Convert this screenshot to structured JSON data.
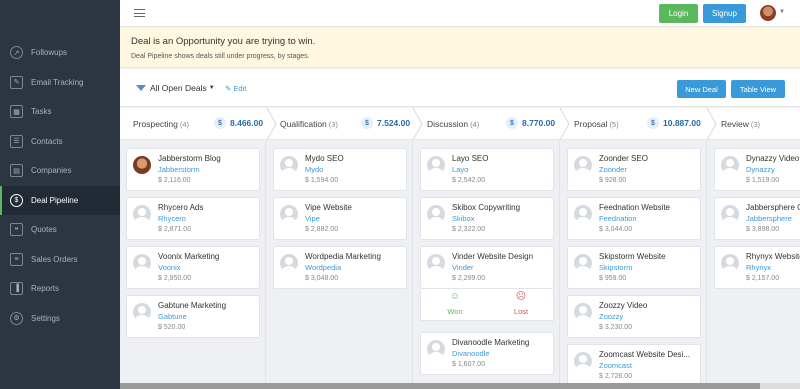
{
  "sidebar": {
    "items": [
      {
        "label": "Followups",
        "icon": "rocket-icon"
      },
      {
        "label": "Email Tracking",
        "icon": "edit-icon"
      },
      {
        "label": "Tasks",
        "icon": "calendar-icon"
      },
      {
        "label": "Contacts",
        "icon": "contacts-icon"
      },
      {
        "label": "Companies",
        "icon": "building-icon"
      },
      {
        "label": "Deal Pipeline",
        "icon": "dollar-icon",
        "active": true
      },
      {
        "label": "Quotes",
        "icon": "quote-icon"
      },
      {
        "label": "Sales Orders",
        "icon": "cart-icon"
      },
      {
        "label": "Reports",
        "icon": "bar-chart-icon"
      },
      {
        "label": "Settings",
        "icon": "gear-icon"
      }
    ]
  },
  "topbar": {
    "login_label": "Login",
    "signup_label": "Signup"
  },
  "banner": {
    "title": "Deal is an Opportunity you are trying to win.",
    "subtitle": "Deal Pipeline shows deals still under progress, by stages."
  },
  "toolbar": {
    "filter_label": "All Open Deals",
    "edit_label": "Edit",
    "new_deal_label": "New Deal",
    "table_view_label": "Table View"
  },
  "stages": [
    {
      "name": "Prospecting",
      "count": "(4)",
      "total": "8.466.00"
    },
    {
      "name": "Qualification",
      "count": "(3)",
      "total": "7.524.00"
    },
    {
      "name": "Discussion",
      "count": "(4)",
      "total": "8.770.00"
    },
    {
      "name": "Proposal",
      "count": "(5)",
      "total": "10.887.00"
    },
    {
      "name": "Review",
      "count": "(3)",
      "total": ""
    }
  ],
  "columns": [
    {
      "cards": [
        {
          "title": "Jabberstorm Blog",
          "org": "Jabberstorm",
          "amount": "$ 2,116.00",
          "photo": true
        },
        {
          "title": "Rhycero Ads",
          "org": "Rhycero",
          "amount": "$ 2,871.00"
        },
        {
          "title": "Voonix Marketing",
          "org": "Voonix",
          "amount": "$ 2,950.00"
        },
        {
          "title": "Gabtune Marketing",
          "org": "Gabtune",
          "amount": "$ 520.00"
        }
      ]
    },
    {
      "cards": [
        {
          "title": "Mydo SEO",
          "org": "Mydo",
          "amount": "$ 1,594.00"
        },
        {
          "title": "Vipe Website",
          "org": "Vipe",
          "amount": "$ 2,882.00"
        },
        {
          "title": "Wordpedia Marketing",
          "org": "Wordpedia",
          "amount": "$ 3,048.00"
        }
      ]
    },
    {
      "cards": [
        {
          "title": "Layo SEO",
          "org": "Layo",
          "amount": "$ 2,542.00"
        },
        {
          "title": "Skibox Copywriting",
          "org": "Skibox",
          "amount": "$ 2,322.00"
        },
        {
          "title": "Vinder Website Design",
          "org": "Vinder",
          "amount": "$ 2,299.00"
        },
        {
          "title": "Divanoodle Marketing",
          "org": "Divanoodle",
          "amount": "$ 1,607.00"
        }
      ],
      "won_label": "Won",
      "lost_label": "Lost"
    },
    {
      "cards": [
        {
          "title": "Zoonder SEO",
          "org": "Zoonder",
          "amount": "$ 928.00"
        },
        {
          "title": "Feednation Website",
          "org": "Feednation",
          "amount": "$ 3,044.00"
        },
        {
          "title": "Skipstorm Website",
          "org": "Skipstorm",
          "amount": "$ 959.00"
        },
        {
          "title": "Zoozzy Video",
          "org": "Zoozzy",
          "amount": "$ 3,230.00"
        },
        {
          "title": "Zoomcast Website Desi...",
          "org": "Zoomcast",
          "amount": "$ 2,726.00"
        }
      ]
    },
    {
      "cards": [
        {
          "title": "Dynazzy Video",
          "org": "Dynazzy",
          "amount": "$ 1,519.00"
        },
        {
          "title": "Jabbersphere C",
          "org": "Jabbersphere",
          "amount": "$ 3,898.00"
        },
        {
          "title": "Rhynyx Website",
          "org": "Rhynyx",
          "amount": "$ 2,157.00"
        }
      ]
    }
  ],
  "colors": {
    "sidebar_bg": "#2c3542",
    "accent_blue": "#3a9ad9",
    "accent_green": "#5cb85c",
    "lost_red": "#d9534f",
    "banner_bg": "#fff8e1"
  }
}
